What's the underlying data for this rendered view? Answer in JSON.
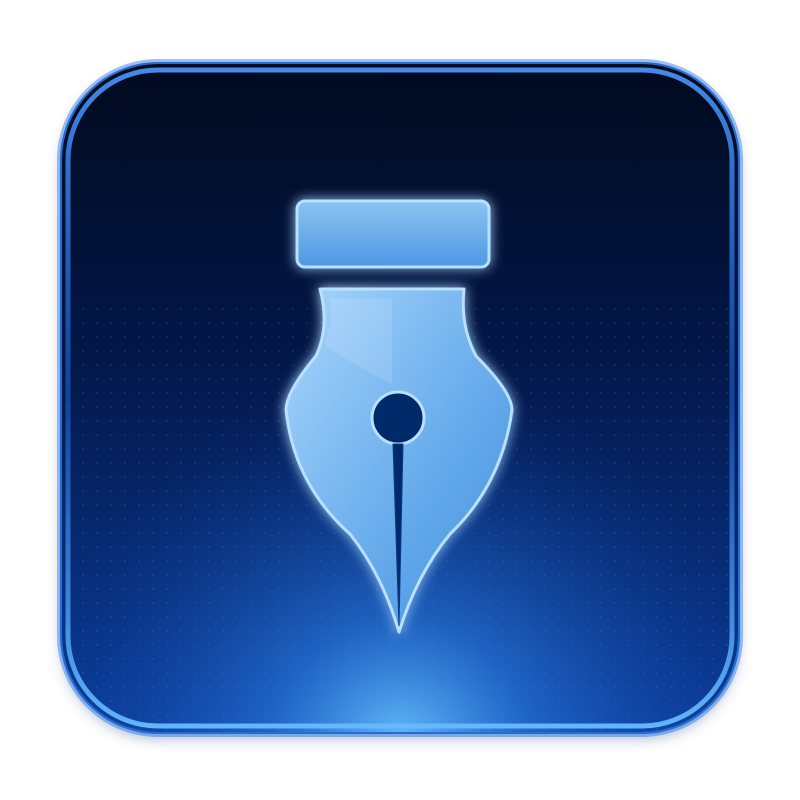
{
  "icon": {
    "name": "fountain-pen-nib-icon",
    "colors": {
      "background_top": "#010a1e",
      "background_bottom": "#0b3c9a",
      "glow": "#3aa2ff",
      "border": "#1f6fd6",
      "nib_fill_light": "#8ec6f7",
      "nib_fill_dark": "#3f8ee0",
      "nib_outline": "#b8e0ff",
      "nib_slit": "#062a6a"
    }
  }
}
